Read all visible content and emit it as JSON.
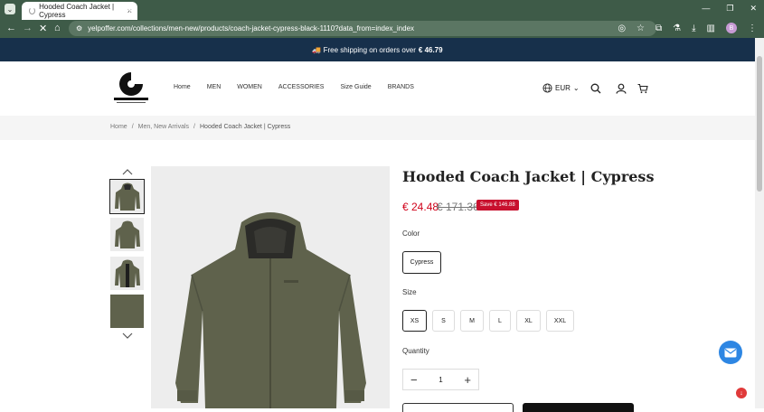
{
  "browser": {
    "tab_title": "Hooded Coach Jacket | Cypress",
    "tab_close": "×",
    "new_tab": "+",
    "url": "yelpoffer.com/collections/men-new/products/coach-jacket-cypress-black-1110?data_from=index_index",
    "profile_initial": "B"
  },
  "promo": {
    "icon": "🚚",
    "text": "Free shipping on orders over",
    "amount": "€ 46.79"
  },
  "nav": {
    "items": [
      "Home",
      "MEN",
      "WOMEN",
      "ACCESSORIES",
      "Size Guide",
      "BRANDS"
    ],
    "currency": "EUR"
  },
  "breadcrumb": {
    "home": "Home",
    "sep": "/",
    "section": "Men, New Arrivals",
    "current": "Hooded Coach Jacket | Cypress"
  },
  "product": {
    "title": "Hooded Coach Jacket | Cypress",
    "price": "€ 24.48",
    "compare_price": "€ 171.36",
    "save_badge": "Save € 146.88",
    "color_label": "Color",
    "color_value": "Cypress",
    "size_label": "Size",
    "sizes": [
      "XS",
      "S",
      "M",
      "L",
      "XL",
      "XXL"
    ],
    "selected_size": "XS",
    "quantity_label": "Quantity",
    "quantity": "1",
    "qty_minus": "−",
    "qty_plus": "+"
  },
  "colors": {
    "browser_chrome": "#3e5b48",
    "promo_bar": "#17304b",
    "price": "#d0021b",
    "save_badge": "#c8102e",
    "jacket": "#5f624c",
    "chat_button": "#2d86e3"
  }
}
